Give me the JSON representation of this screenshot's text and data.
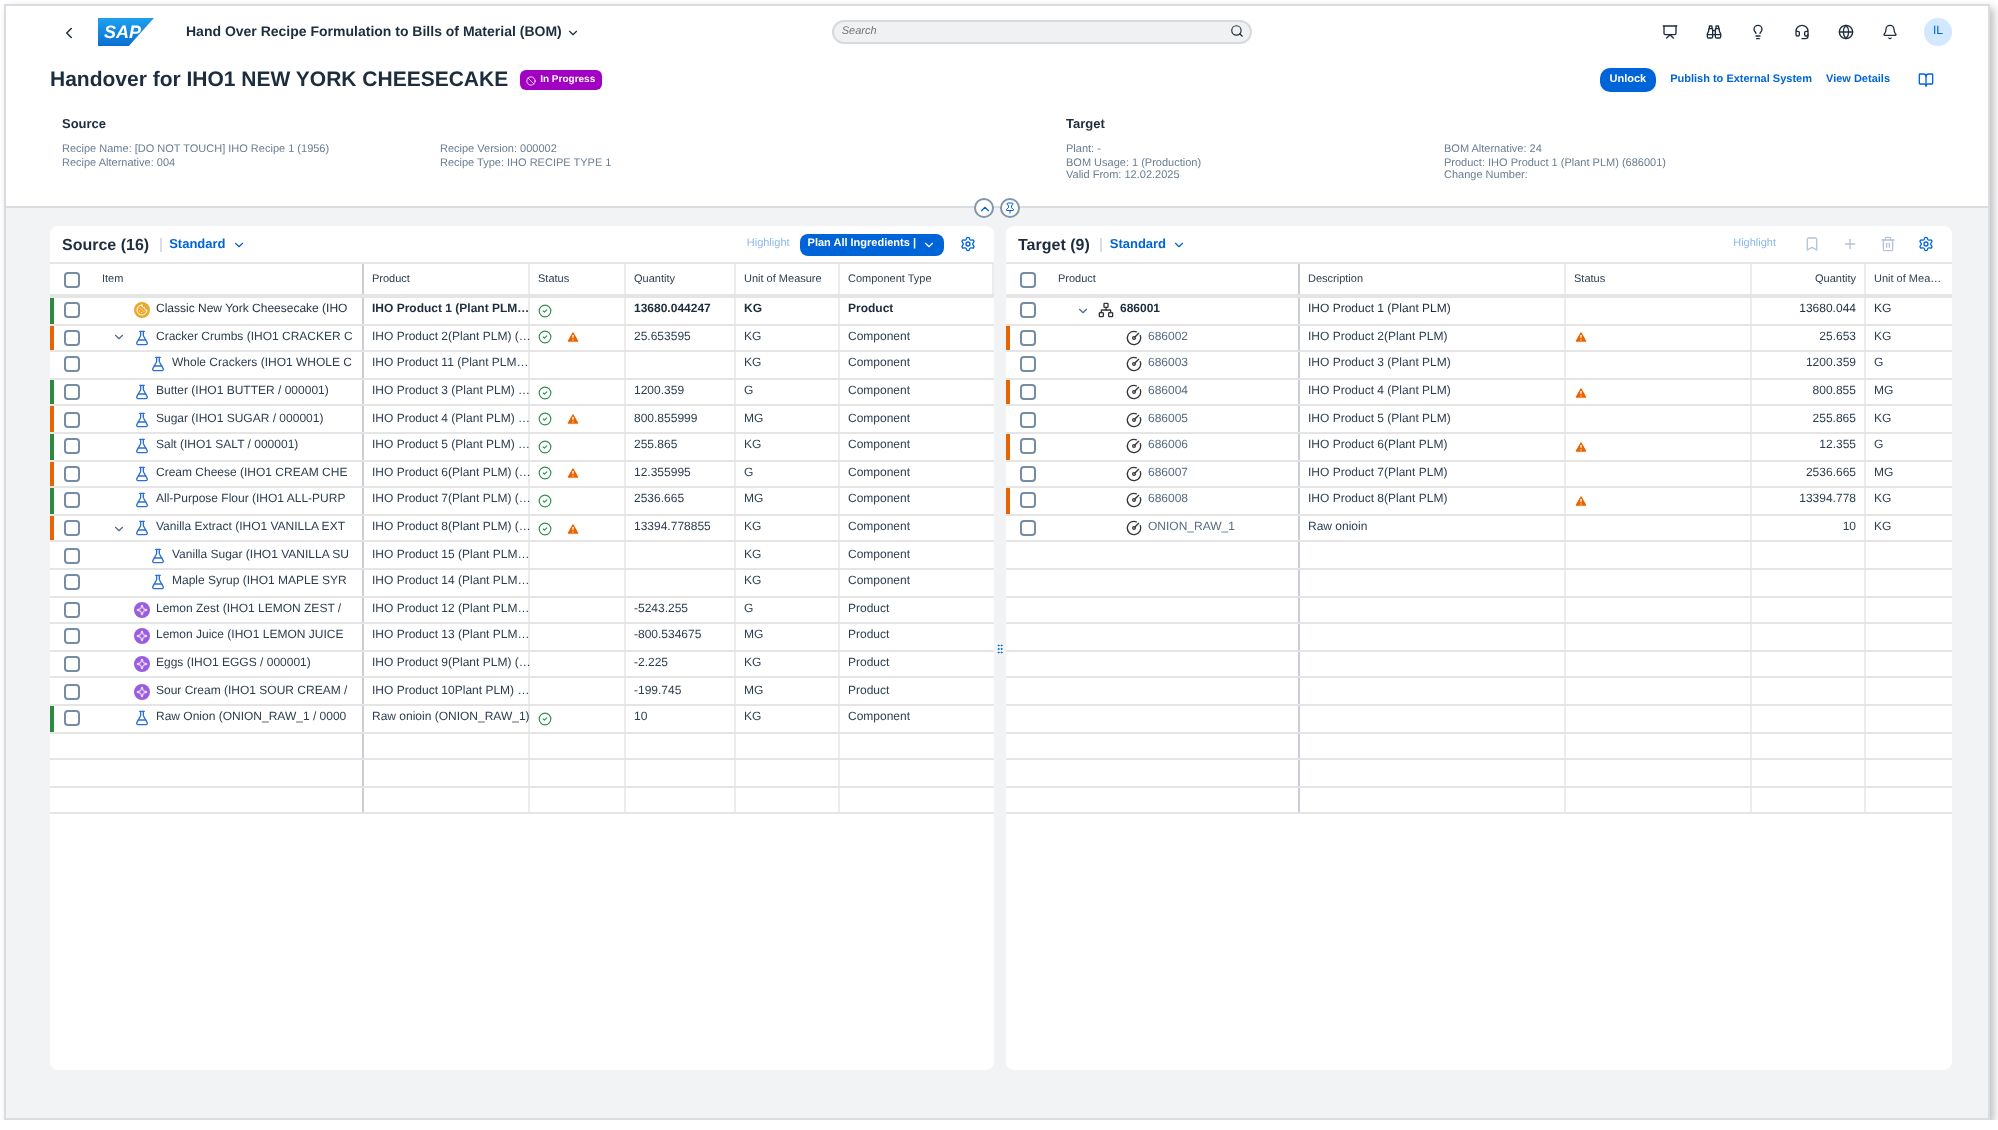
{
  "shell": {
    "logo": "SAP",
    "title": "Hand Over Recipe Formulation to Bills of Material (BOM)",
    "search": {
      "placeholder": "Search"
    },
    "avatar": "IL"
  },
  "page": {
    "title": "Handover for IHO1 NEW YORK CHEESECAKE",
    "status": "In Progress",
    "actions": [
      {
        "label": "Unlock",
        "kind": "primary"
      },
      {
        "label": "Publish to External System",
        "kind": "link"
      },
      {
        "label": "View Details",
        "kind": "link"
      }
    ]
  },
  "source_info": {
    "heading": "Source",
    "columns": [
      [
        "Recipe Name: [DO NOT TOUCH] IHO Recipe 1 (1956)",
        "Recipe Alternative: 004"
      ],
      [
        "Recipe Version: 000002",
        "Recipe Type: IHO RECIPE TYPE 1"
      ]
    ]
  },
  "target_info": {
    "heading": "Target",
    "columns": [
      [
        "Plant: -",
        "BOM Usage: 1 (Production)",
        "Valid From: 12.02.2025"
      ],
      [
        "BOM Alternative: 24",
        "Product: IHO Product 1 (Plant PLM) (686001)",
        "Change Number:"
      ]
    ]
  },
  "source_table": {
    "title": "Source (16)",
    "variant": "Standard",
    "highlight": "Highlight",
    "plan_button": "Plan All Ingredients |",
    "all_checked": false,
    "columns": [
      "Item",
      "Product",
      "Status",
      "Quantity",
      "Unit of Measure",
      "Component Type"
    ],
    "rows": [
      {
        "kind": "cake",
        "item": "Classic New York Cheesecake (IHO",
        "product": "IHO Product 1 (Plant PLM…",
        "ok": true,
        "warning": false,
        "quantity": "13680.044247",
        "unit": "KG",
        "type": "Product",
        "color": "#2b8a3e",
        "checked": false,
        "emphasized": true
      },
      {
        "kind": "flask",
        "item": "Cracker Crumbs (IHO1 CRACKER C",
        "product": "IHO Product 2(Plant PLM) (…",
        "ok": true,
        "warning": true,
        "quantity": "25.653595",
        "unit": "KG",
        "type": "Component",
        "color": "#e76500",
        "checked": false,
        "emphasized": false,
        "expanded": true,
        "children": [
          {
            "kind": "flask",
            "item": "Whole Crackers (IHO1 WHOLE C",
            "product": "IHO Product 11 (Plant PLM…",
            "ok": false,
            "warning": false,
            "unit": "KG",
            "type": "Component",
            "checked": false,
            "emphasized": false
          }
        ]
      },
      {
        "kind": "flask",
        "item": "Butter (IHO1 BUTTER / 000001)",
        "product": "IHO Product 3 (Plant PLM) …",
        "ok": true,
        "warning": false,
        "quantity": "1200.359",
        "unit": "G",
        "type": "Component",
        "color": "#2b8a3e",
        "checked": false,
        "emphasized": false
      },
      {
        "kind": "flask",
        "item": "Sugar (IHO1 SUGAR / 000001)",
        "product": "IHO Product 4 (Plant PLM) …",
        "ok": true,
        "warning": true,
        "quantity": "800.855999",
        "unit": "MG",
        "type": "Component",
        "color": "#e76500",
        "checked": false,
        "emphasized": false
      },
      {
        "kind": "flask",
        "item": "Salt (IHO1 SALT / 000001)",
        "product": "IHO Product 5 (Plant PLM) …",
        "ok": true,
        "warning": false,
        "quantity": "255.865",
        "unit": "KG",
        "type": "Component",
        "color": "#2b8a3e",
        "checked": false,
        "emphasized": false
      },
      {
        "kind": "flask",
        "item": "Cream Cheese (IHO1 CREAM CHE",
        "product": "IHO Product 6(Plant PLM) (…",
        "ok": true,
        "warning": true,
        "quantity": "12.355995",
        "unit": "G",
        "type": "Component",
        "color": "#e76500",
        "checked": false,
        "emphasized": false
      },
      {
        "kind": "flask",
        "item": "All-Purpose Flour (IHO1 ALL-PURP",
        "product": "IHO Product 7(Plant PLM) (…",
        "ok": true,
        "warning": false,
        "quantity": "2536.665",
        "unit": "MG",
        "type": "Component",
        "color": "#2b8a3e",
        "checked": false,
        "emphasized": false
      },
      {
        "kind": "flask",
        "item": "Vanilla Extract (IHO1 VANILLA EXT",
        "product": "IHO Product 8(Plant PLM) (…",
        "ok": true,
        "warning": true,
        "quantity": "13394.778855",
        "unit": "KG",
        "type": "Component",
        "color": "#e76500",
        "checked": false,
        "emphasized": false,
        "expanded": true,
        "children": [
          {
            "kind": "flask",
            "item": "Vanilla Sugar (IHO1 VANILLA SU",
            "product": "IHO Product 15 (Plant PLM…",
            "ok": false,
            "warning": false,
            "unit": "KG",
            "type": "Component",
            "checked": false,
            "emphasized": false
          },
          {
            "kind": "flask",
            "item": "Maple Syrup (IHO1 MAPLE SYR",
            "product": "IHO Product 14 (Plant PLM…",
            "ok": false,
            "warning": false,
            "unit": "KG",
            "type": "Component",
            "checked": false,
            "emphasized": false
          }
        ]
      },
      {
        "kind": "ingredient",
        "item": "Lemon Zest (IHO1 LEMON ZEST /",
        "product": "IHO Product 12 (Plant PLM…",
        "ok": false,
        "warning": false,
        "quantity": "-5243.255",
        "unit": "G",
        "type": "Product",
        "checked": false,
        "emphasized": false
      },
      {
        "kind": "ingredient",
        "item": "Lemon Juice (IHO1 LEMON JUICE",
        "product": "IHO Product 13 (Plant PLM…",
        "ok": false,
        "warning": false,
        "quantity": "-800.534675",
        "unit": "MG",
        "type": "Product",
        "checked": false,
        "emphasized": false
      },
      {
        "kind": "ingredient",
        "item": "Eggs (IHO1 EGGS / 000001)",
        "product": "IHO Product 9(Plant PLM) (…",
        "ok": false,
        "warning": false,
        "quantity": "-2.225",
        "unit": "KG",
        "type": "Product",
        "checked": false,
        "emphasized": false
      },
      {
        "kind": "ingredient",
        "item": "Sour Cream (IHO1 SOUR CREAM /",
        "product": "IHO Product 10Plant PLM) …",
        "ok": false,
        "warning": false,
        "quantity": "-199.745",
        "unit": "MG",
        "type": "Product",
        "checked": false,
        "emphasized": false
      },
      {
        "kind": "flask",
        "item": "Raw Onion (ONION_RAW_1 / 0000",
        "product": "Raw onioin (ONION_RAW_1)",
        "ok": true,
        "warning": false,
        "quantity": "10",
        "unit": "KG",
        "type": "Component",
        "color": "#2b8a3e",
        "checked": false,
        "emphasized": false
      }
    ]
  },
  "target_table": {
    "title": "Target (9)",
    "variant": "Standard",
    "highlight": "Highlight",
    "all_checked": false,
    "columns": [
      "Product",
      "Description",
      "Status",
      "Quantity",
      "Unit of Mea…"
    ],
    "rows": [
      {
        "kind": "structure",
        "product": "686001",
        "description": "IHO Product 1 (Plant PLM)",
        "warning": false,
        "quantity": "13680.044",
        "unit": "KG",
        "checked": false,
        "emphasized": true,
        "expanded": true,
        "children": [
          {
            "kind": "material",
            "product": "686002",
            "description": "IHO Product 2(Plant PLM)",
            "warning": true,
            "quantity": "25.653",
            "unit": "KG",
            "color": "#e76500",
            "checked": false,
            "emphasized": false
          },
          {
            "kind": "material",
            "product": "686003",
            "description": "IHO Product 3 (Plant PLM)",
            "warning": false,
            "quantity": "1200.359",
            "unit": "G",
            "checked": false,
            "emphasized": false
          },
          {
            "kind": "material",
            "product": "686004",
            "description": "IHO Product 4 (Plant PLM)",
            "warning": true,
            "quantity": "800.855",
            "unit": "MG",
            "color": "#e76500",
            "checked": false,
            "emphasized": false
          },
          {
            "kind": "material",
            "product": "686005",
            "description": "IHO Product 5 (Plant PLM)",
            "warning": false,
            "quantity": "255.865",
            "unit": "KG",
            "checked": false,
            "emphasized": false
          },
          {
            "kind": "material",
            "product": "686006",
            "description": "IHO Product 6(Plant PLM)",
            "warning": true,
            "quantity": "12.355",
            "unit": "G",
            "color": "#e76500",
            "checked": false,
            "emphasized": false
          },
          {
            "kind": "material",
            "product": "686007",
            "description": "IHO Product 7(Plant PLM)",
            "warning": false,
            "quantity": "2536.665",
            "unit": "MG",
            "checked": false,
            "emphasized": false
          },
          {
            "kind": "material",
            "product": "686008",
            "description": "IHO Product 8(Plant PLM)",
            "warning": true,
            "quantity": "13394.778",
            "unit": "KG",
            "color": "#e76500",
            "checked": false,
            "emphasized": false
          },
          {
            "kind": "material",
            "product": "ONION_RAW_1",
            "description": "Raw onioin",
            "warning": false,
            "quantity": "10",
            "unit": "KG",
            "checked": false,
            "emphasized": false
          }
        ]
      }
    ]
  }
}
